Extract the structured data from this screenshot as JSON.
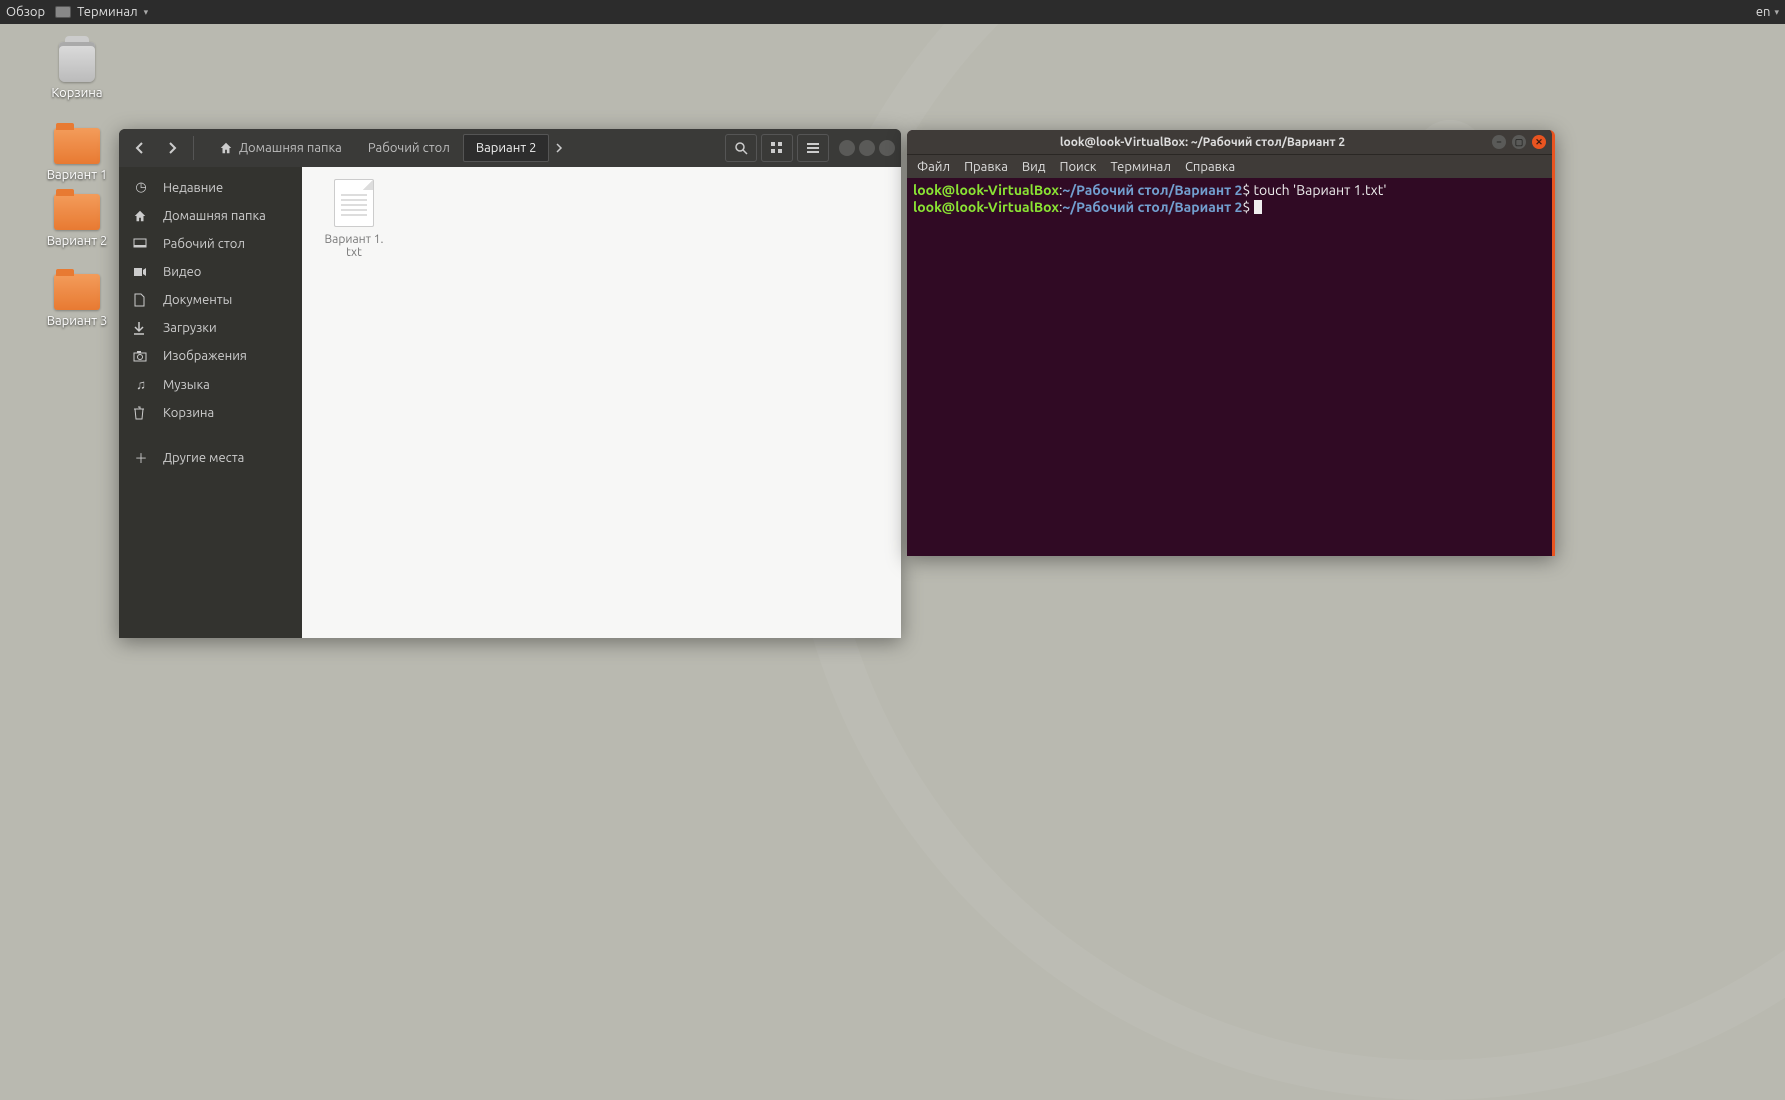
{
  "topbar": {
    "activities": "Обзор",
    "app_name": "Терминал",
    "lang": "en"
  },
  "desktop": {
    "trash": "Корзина",
    "folders": [
      "Вариант 1",
      "Вариант 2",
      "Вариант 3"
    ]
  },
  "fm": {
    "breadcrumbs": {
      "home": "Домашняя папка",
      "desktop": "Рабочий стол",
      "current": "Вариант 2"
    },
    "sidebar": {
      "recent": "Недавние",
      "home": "Домашняя папка",
      "desktop": "Рабочий стол",
      "videos": "Видео",
      "documents": "Документы",
      "downloads": "Загрузки",
      "pictures": "Изображения",
      "music": "Музыка",
      "trash": "Корзина",
      "other": "Другие места"
    },
    "files": {
      "item0_line1": "Вариант 1.",
      "item0_line2": "txt"
    }
  },
  "terminal": {
    "title": "look@look-VirtualBox: ~/Рабочий стол/Вариант 2",
    "menu": {
      "file": "Файл",
      "edit": "Правка",
      "view": "Вид",
      "search": "Поиск",
      "terminal": "Терминал",
      "help": "Справка"
    },
    "prompt_user": "look@look-VirtualBox",
    "prompt_path": "~/Рабочий стол/Вариант 2",
    "command1": "touch 'Вариант 1.txt'"
  }
}
